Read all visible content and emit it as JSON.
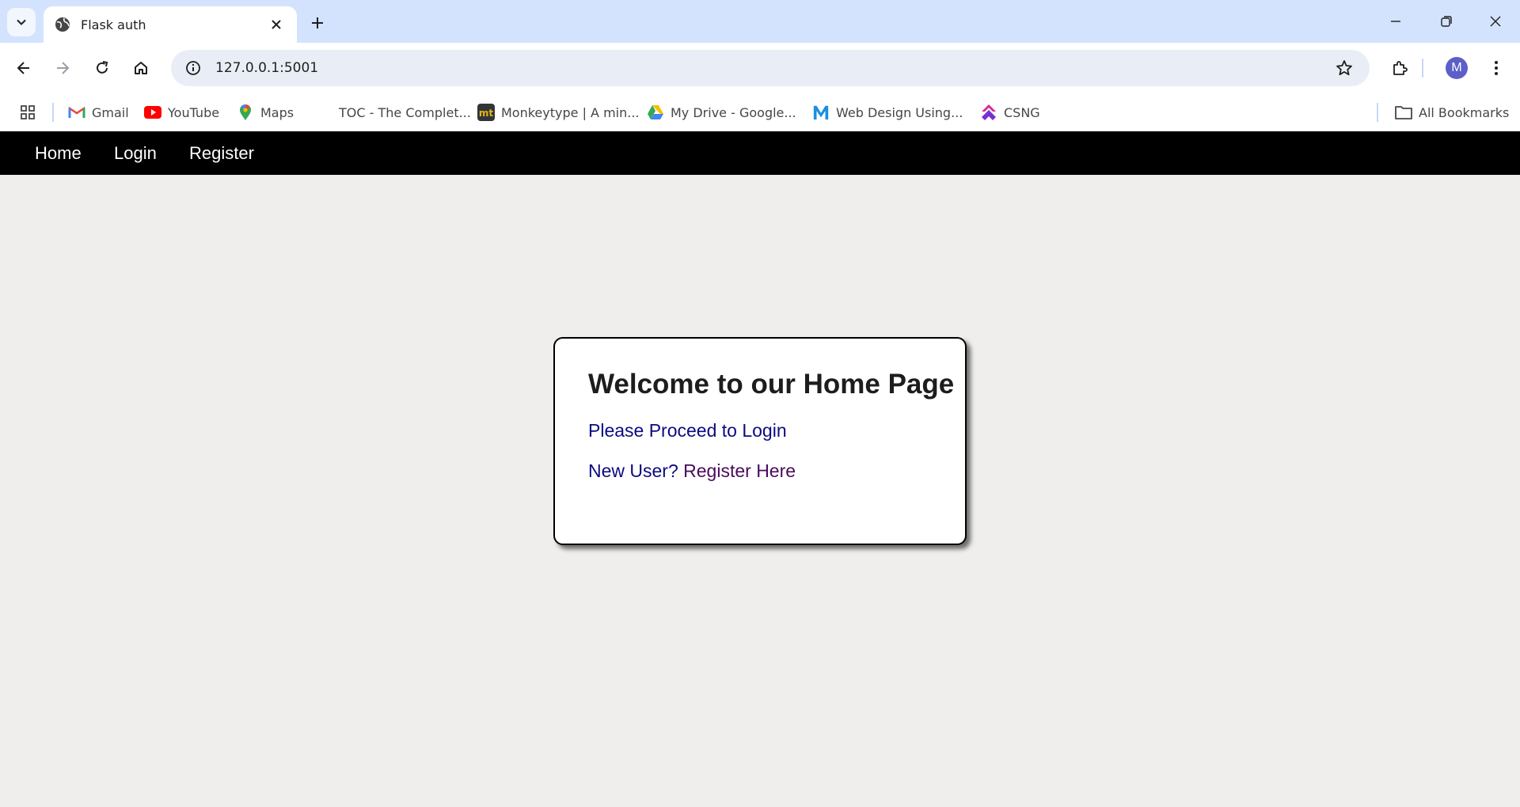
{
  "browser": {
    "tab": {
      "title": "Flask auth"
    },
    "address": {
      "url": "127.0.0.1:5001"
    },
    "profile_initial": "M",
    "bookmarks": [
      {
        "label": "Gmail",
        "icon": "gmail-icon"
      },
      {
        "label": "YouTube",
        "icon": "youtube-icon"
      },
      {
        "label": "Maps",
        "icon": "maps-icon"
      },
      {
        "label": "TOC - The Complet...",
        "icon": "blank-page-icon"
      },
      {
        "label": "Monkeytype | A min...",
        "icon": "monkeytype-icon"
      },
      {
        "label": "My Drive - Google...",
        "icon": "google-drive-icon"
      },
      {
        "label": "Web Design Using...",
        "icon": "m-logo-icon"
      },
      {
        "label": "CSNG",
        "icon": "csng-icon"
      }
    ],
    "all_bookmarks_label": "All Bookmarks"
  },
  "site": {
    "nav": {
      "home": "Home",
      "login": "Login",
      "register": "Register"
    },
    "card": {
      "heading": "Welcome to our Home Page",
      "proceed_text": "Please Proceed to ",
      "login_link": "Login",
      "new_user_text": "New User? ",
      "register_link": "Register Here"
    }
  },
  "colors": {
    "tabstrip": "#d3e3fd",
    "site_nav_bg": "#000000",
    "page_bg": "#efeeec",
    "link_blue": "#0b0b80",
    "link_visited": "#4a0a5e"
  }
}
